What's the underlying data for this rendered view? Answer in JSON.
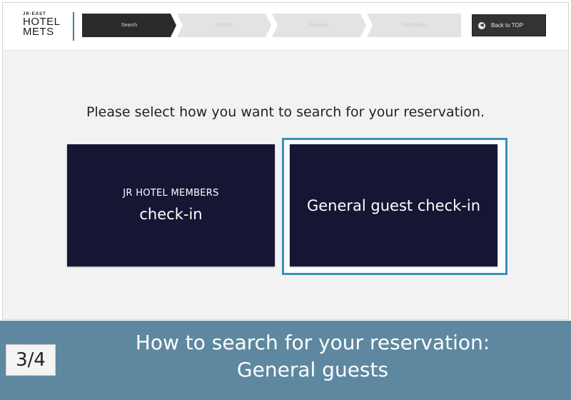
{
  "header": {
    "logo": {
      "small": "JR-EAST",
      "line1": "HOTEL",
      "line2": "METS"
    },
    "steps": [
      {
        "label": "Search",
        "active": true
      },
      {
        "label": "Confirm",
        "active": false
      },
      {
        "label": "Payment",
        "active": false
      },
      {
        "label": "Publication",
        "active": false
      }
    ],
    "back_button": {
      "label": "Back to TOP",
      "icon": "back-arrow-icon"
    }
  },
  "main": {
    "prompt": "Please select how you want to search for your reservation.",
    "options": [
      {
        "line1": "JR HOTEL MEMBERS",
        "line2": "check-in",
        "selected": false
      },
      {
        "line1": "General guest check-in",
        "selected": true
      }
    ]
  },
  "footer": {
    "counter": "3/4",
    "caption_line1": "How to search for your reservation:",
    "caption_line2": "General guests"
  },
  "colors": {
    "button_bg": "#141634",
    "selection_border": "#3a8fb8",
    "caption_bg": "#5e889f",
    "active_step": "#2a2a2a"
  }
}
